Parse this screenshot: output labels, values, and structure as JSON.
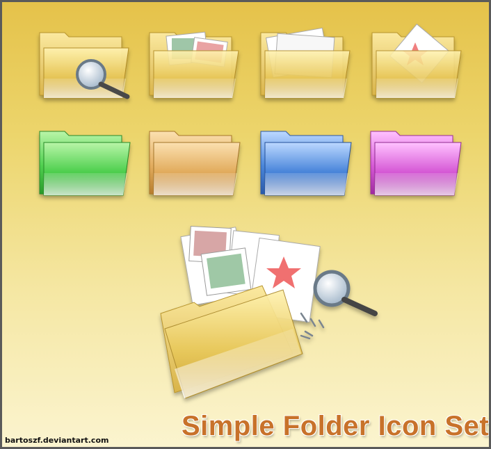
{
  "title": "Simple Folder Icon Set",
  "credit": "bartoszf.deviantart.com",
  "background": {
    "top": "#e5c24a",
    "bottom": "#fbf4cf",
    "border": "#5a5a5a"
  },
  "title_color": "#c8722a",
  "icons": [
    {
      "name": "folder-search-icon",
      "color": "yellow"
    },
    {
      "name": "folder-images-icon",
      "color": "yellow"
    },
    {
      "name": "folder-documents-icon",
      "color": "yellow"
    },
    {
      "name": "folder-favorites-icon",
      "color": "yellow"
    },
    {
      "name": "folder-green-icon",
      "color": "#5fd15f"
    },
    {
      "name": "folder-orange-icon",
      "color": "#e8b46a"
    },
    {
      "name": "folder-blue-icon",
      "color": "#4f86d6"
    },
    {
      "name": "folder-magenta-icon",
      "color": "#d85ad8"
    },
    {
      "name": "folder-composite-icon",
      "color": "yellow"
    }
  ]
}
